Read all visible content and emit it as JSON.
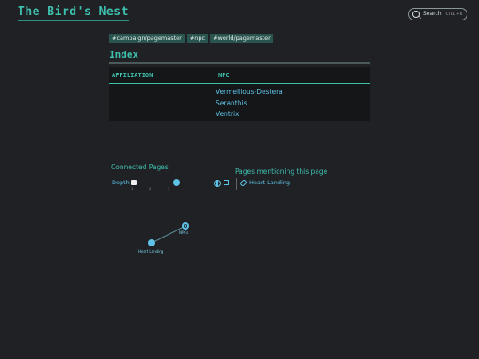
{
  "site": {
    "title": "The Bird's Nest"
  },
  "search": {
    "label": "Search",
    "shortcut": "CTRL + K",
    "icon": "search-icon"
  },
  "tags": [
    "#campaign/pagemaster",
    "#npc",
    "#world/pagemaster"
  ],
  "page": {
    "heading": "Index"
  },
  "table": {
    "headers": [
      "AFFILIATION",
      "NPC"
    ],
    "rows": [
      {
        "affiliation": "",
        "npcs": [
          "Vermellious-Destera",
          "Seranthis",
          "Ventrix"
        ]
      }
    ]
  },
  "graph": {
    "title": "Connected Pages",
    "depth_label": "Depth",
    "depth_ticks": [
      "1",
      "2",
      "3"
    ],
    "depth_value": 3,
    "nodes": [
      {
        "label": "NPCs",
        "current": true
      },
      {
        "label": "Heart Landing",
        "current": false
      }
    ]
  },
  "mentions": {
    "title": "Pages mentioning this page",
    "links": [
      "Heart Landing"
    ]
  },
  "colors": {
    "accent": "#3fbfae",
    "link": "#5fc3e8",
    "background": "#1f2124",
    "table_bg": "#141618"
  }
}
